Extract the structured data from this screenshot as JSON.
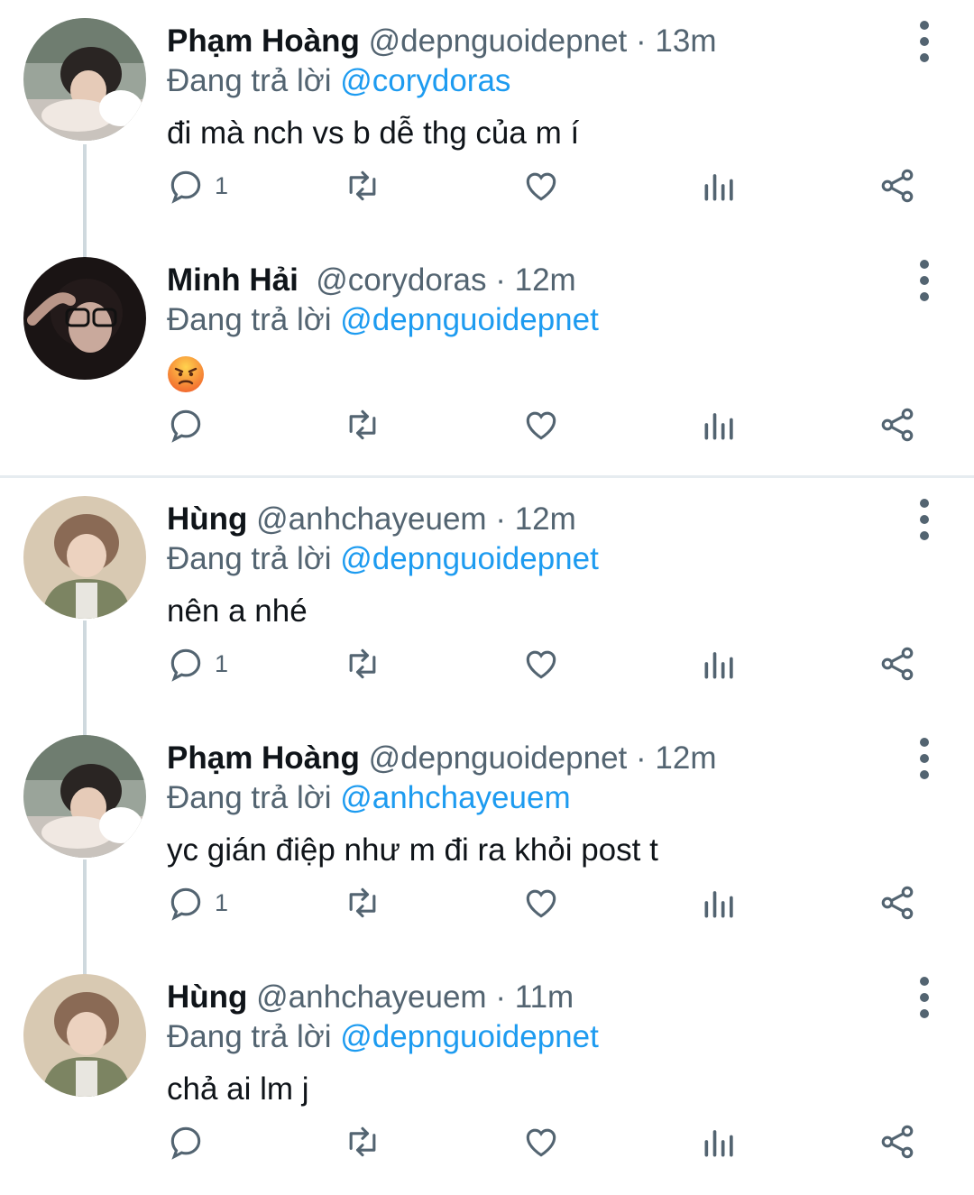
{
  "tweets": [
    {
      "name": "Phạm Hoàng",
      "handle": "@depnguoidepnet",
      "sep": "·",
      "time": "13m",
      "reply_prefix": "Đang trả lời",
      "reply_to": "@corydoras",
      "text": "đi mà nch vs b dễ thg của m í",
      "reply_count": "1"
    },
    {
      "name": "Minh Hải",
      "handle": "@corydoras",
      "sep": "·",
      "time": "12m",
      "reply_prefix": "Đang trả lời",
      "reply_to": "@depnguoidepnet",
      "text": "😡",
      "reply_count": ""
    },
    {
      "name": "Hùng",
      "handle": "@anhchayeuem",
      "sep": "·",
      "time": "12m",
      "reply_prefix": "Đang trả lời",
      "reply_to": "@depnguoidepnet",
      "text": "nên a nhé",
      "reply_count": "1"
    },
    {
      "name": "Phạm Hoàng",
      "handle": "@depnguoidepnet",
      "sep": "·",
      "time": "12m",
      "reply_prefix": "Đang trả lời",
      "reply_to": "@anhchayeuem",
      "text": "yc gián điệp như m đi ra khỏi post t",
      "reply_count": "1"
    },
    {
      "name": "Hùng",
      "handle": "@anhchayeuem",
      "sep": "·",
      "time": "11m",
      "reply_prefix": "Đang trả lời",
      "reply_to": "@depnguoidepnet",
      "text": "chả ai lm j",
      "reply_count": ""
    }
  ],
  "icons": {
    "reply": "reply-icon",
    "retweet": "retweet-icon",
    "like": "heart-icon",
    "views": "views-icon",
    "share": "share-icon",
    "more": "more-vertical-icon"
  },
  "colors": {
    "text": "#0f1419",
    "secondary": "#536471",
    "link": "#1d9bf0",
    "thread_line": "#cfd9de"
  }
}
